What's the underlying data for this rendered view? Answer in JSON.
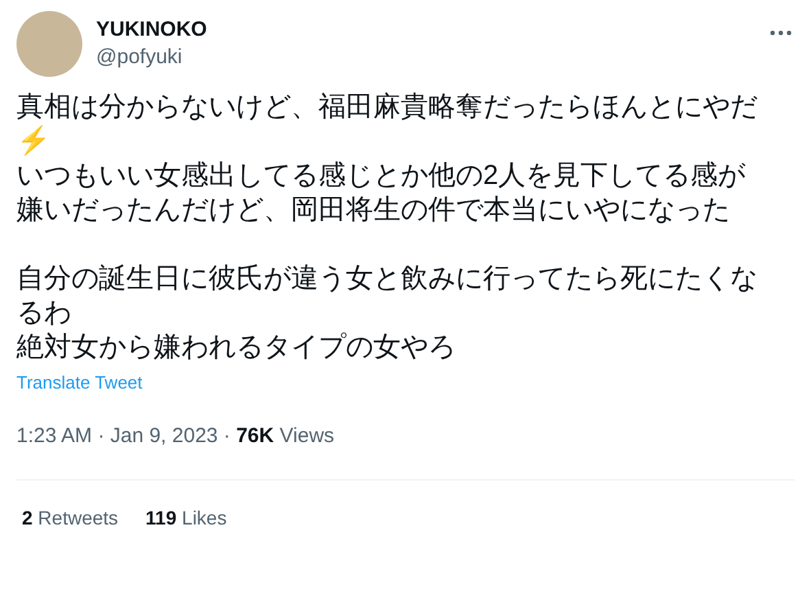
{
  "author": {
    "name": "YUKINOKO",
    "handle": "@pofyuki"
  },
  "tweet": {
    "paragraphs": [
      [
        "真相は分からないけど、福田麻貴略奪だったらほんとにやだ⚡",
        "いつもいい女感出してる感じとか他の2人を見下してる感が嫌いだったんだけど、岡田将生の件で本当にいやになった"
      ],
      [
        "自分の誕生日に彼氏が違う女と飲みに行ってたら死にたくなるわ",
        "絶対女から嫌われるタイプの女やろ"
      ]
    ],
    "translate": "Translate Tweet",
    "meta": "1:23 AM · Jan 9, 2023 · **76K** Views"
  },
  "stats": [
    {
      "text": "**2** Retweets"
    },
    {
      "text": "**119** Likes"
    }
  ]
}
